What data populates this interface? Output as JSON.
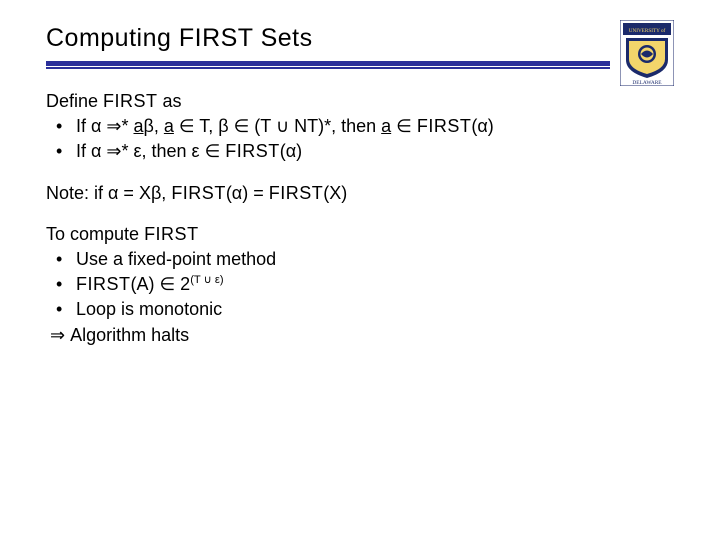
{
  "title": {
    "pre": "Computing ",
    "tt": "FIRST",
    "post": " Sets"
  },
  "logo": {
    "top_text": "UNIVERSITY of",
    "bottom_text": "DELAWARE"
  },
  "define": {
    "heading_pre": "Define ",
    "heading_tt": "FIRST",
    "heading_post": " as",
    "b1": {
      "p1": "If α ⇒* ",
      "u1": "a",
      "p2": "β, ",
      "u2": "a",
      "p3": " ∈ T, β ∈ (T ∪ NT)*, then ",
      "u3": "a",
      "p4": " ∈ ",
      "tt": "FIRST",
      "p5": "(α)"
    },
    "b2": {
      "p1": "If α ⇒* ε, then ε ∈ ",
      "tt": "FIRST",
      "p2": "(α)"
    }
  },
  "note": {
    "p1": "Note: if α = Xβ, ",
    "tt1": "FIRST",
    "p2": "(α) = ",
    "tt2": "FIRST",
    "p3": "(X)"
  },
  "compute": {
    "heading_pre": "To compute ",
    "heading_tt": "FIRST",
    "b1": "Use a fixed-point method",
    "b2": {
      "tt": "FIRST",
      "p1": "(A) ∈ 2",
      "sup": "(T ∪ ε)"
    },
    "b3": "Loop is monotonic",
    "tail": {
      "arrow": "⇒ ",
      "text": "Algorithm halts"
    }
  }
}
